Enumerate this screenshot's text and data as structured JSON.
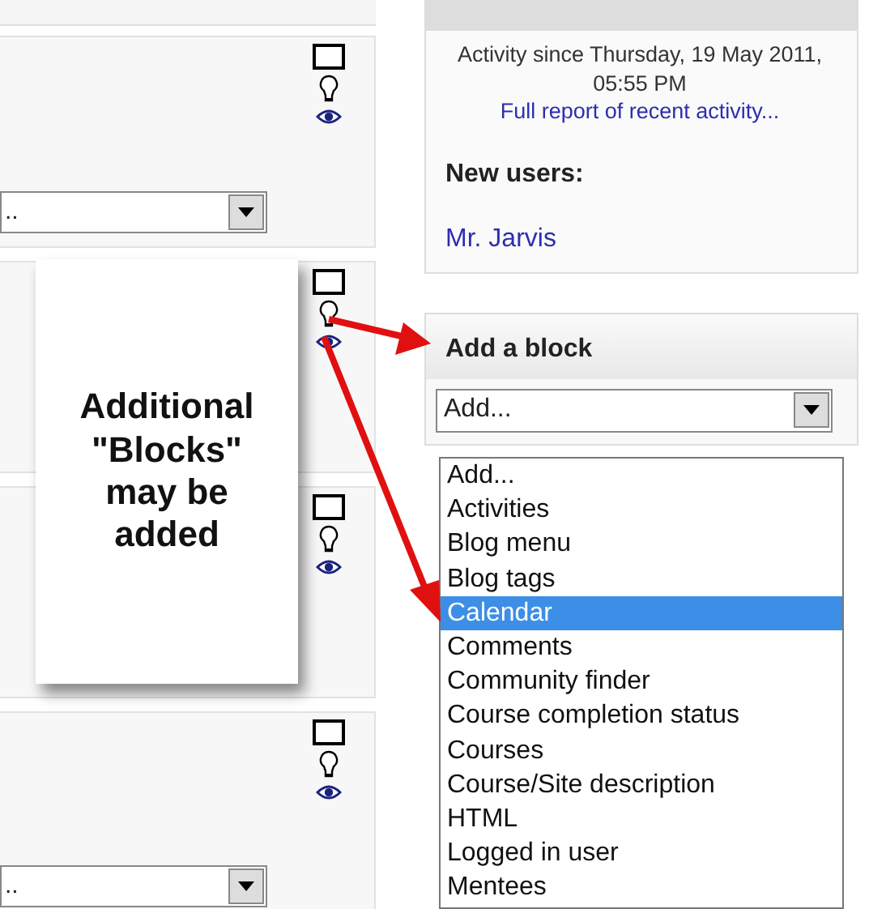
{
  "recent_activity": {
    "since": "Activity since Thursday, 19 May 2011, 05:55 PM",
    "report_link": "Full report of recent activity...",
    "new_users_heading": "New users:",
    "users": [
      "Mr. Jarvis"
    ]
  },
  "sections": [
    {
      "kind": "with-select",
      "select_value": ".."
    },
    {
      "kind": "plain"
    },
    {
      "kind": "plain"
    },
    {
      "kind": "with-select",
      "select_value": ".."
    }
  ],
  "add_block": {
    "title": "Add a block",
    "select_value": "Add...",
    "options": [
      {
        "label": "Add...",
        "selected": false
      },
      {
        "label": "Activities",
        "selected": false
      },
      {
        "label": "Blog menu",
        "selected": false
      },
      {
        "label": "Blog tags",
        "selected": false
      },
      {
        "label": "Calendar",
        "selected": true
      },
      {
        "label": "Comments",
        "selected": false
      },
      {
        "label": "Community finder",
        "selected": false
      },
      {
        "label": "Course completion status",
        "selected": false
      },
      {
        "label": "Courses",
        "selected": false
      },
      {
        "label": "Course/Site description",
        "selected": false
      },
      {
        "label": "HTML",
        "selected": false
      },
      {
        "label": "Logged in user",
        "selected": false
      },
      {
        "label": "Mentees",
        "selected": false
      }
    ]
  },
  "callout": {
    "text": "Additional \"Blocks\" may be added"
  }
}
